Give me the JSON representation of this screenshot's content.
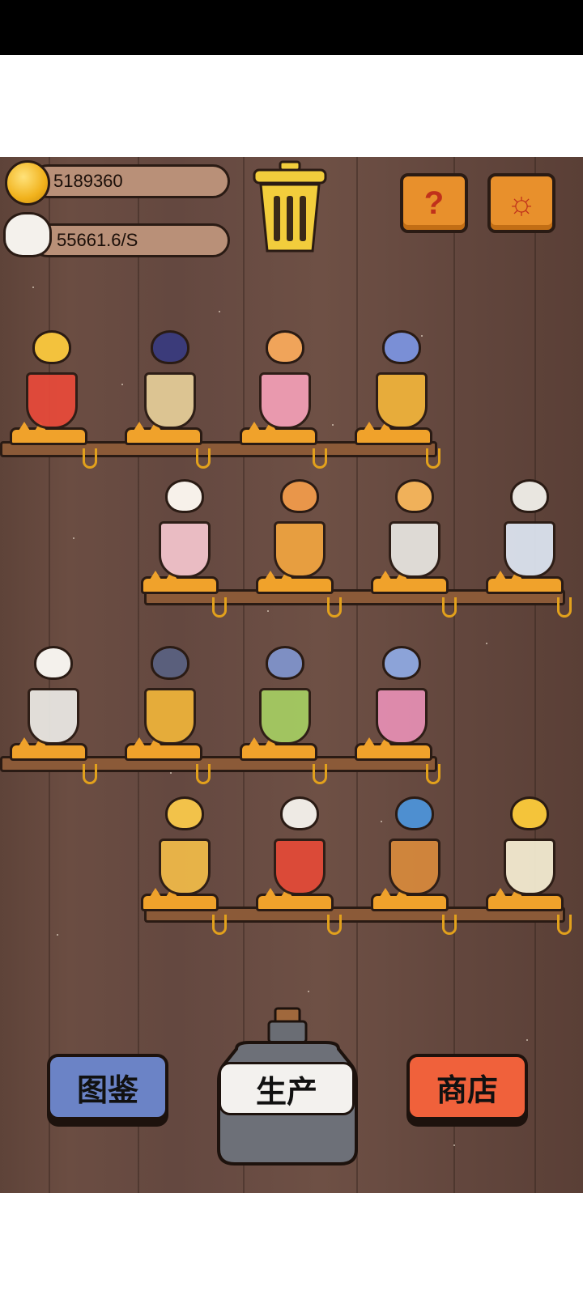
{
  "currency": {
    "coins": "5189360",
    "rate": "55661.6/S"
  },
  "buttons": {
    "catalog": "图鉴",
    "produce": "生产",
    "shop": "商店",
    "help_icon": "?",
    "settings_icon": "☼"
  },
  "icons": [
    "coin-icon",
    "money-bag-icon",
    "trash-can-icon",
    "help-icon",
    "settings-icon",
    "bottle-icon"
  ],
  "colors": {
    "catalog_button": "#6b83c6",
    "shop_button": "#f0613b",
    "top_buttons": "#e8902c",
    "shelf": "#8b5a38",
    "background": "#654840"
  },
  "shelves": [
    {
      "row": 1,
      "cats": [
        "royal-cat",
        "purple-cat-in-grape-glass",
        "llama-cat-in-cocktail",
        "wizard-cat-in-beer-mug"
      ]
    },
    {
      "row": 2,
      "cats": [
        "guitar-cat-in-sundae",
        "red-hat-cat-in-wine-glass",
        "tea-cat-in-cup",
        "detective-cat-in-teacup"
      ]
    },
    {
      "row": 3,
      "cats": [
        "emperor-cat-in-bowl",
        "two-cats-in-beer",
        "sunflower-cat-in-glass",
        "sleeping-cat-in-parfait"
      ]
    },
    {
      "row": 4,
      "cats": [
        "sunglasses-cat-in-glass",
        "red-jacket-cat-in-bowl",
        "apple-cat-in-pitcher",
        "golden-armor-cat-in-cup"
      ]
    }
  ]
}
